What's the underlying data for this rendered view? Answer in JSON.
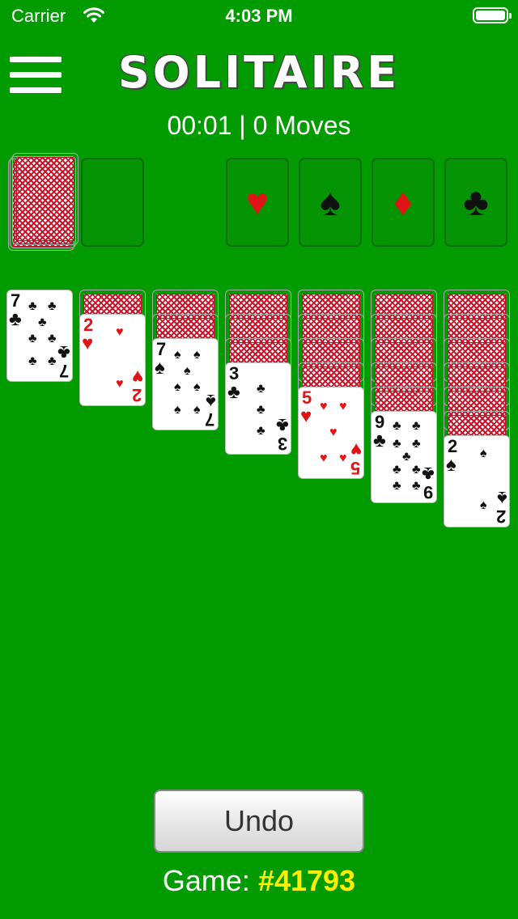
{
  "status_bar": {
    "carrier": "Carrier",
    "time": "4:03 PM"
  },
  "header": {
    "title": "SOLITAIRE",
    "stats": "00:01 | 0 Moves"
  },
  "foundations": [
    {
      "suit": "hearts",
      "glyph": "♥",
      "color": "#e01414"
    },
    {
      "suit": "spades",
      "glyph": "♠",
      "color": "#111111"
    },
    {
      "suit": "diamonds",
      "glyph": "♦",
      "color": "#e01414"
    },
    {
      "suit": "clubs",
      "glyph": "♣",
      "color": "#111111"
    }
  ],
  "tableau": [
    {
      "hidden": 0,
      "top": {
        "rank": "7",
        "suit": "♣",
        "color": "black"
      }
    },
    {
      "hidden": 1,
      "top": {
        "rank": "2",
        "suit": "♥",
        "color": "red"
      }
    },
    {
      "hidden": 2,
      "top": {
        "rank": "7",
        "suit": "♠",
        "color": "black"
      }
    },
    {
      "hidden": 3,
      "top": {
        "rank": "3",
        "suit": "♣",
        "color": "black"
      }
    },
    {
      "hidden": 4,
      "top": {
        "rank": "5",
        "suit": "♥",
        "color": "red"
      }
    },
    {
      "hidden": 5,
      "top": {
        "rank": "9",
        "suit": "♣",
        "color": "black"
      }
    },
    {
      "hidden": 6,
      "top": {
        "rank": "2",
        "suit": "♠",
        "color": "black"
      }
    }
  ],
  "footer": {
    "undo_label": "Undo",
    "game_label": "Game:",
    "game_number": "#41793"
  },
  "colors": {
    "felt": "#029b02",
    "card_back": "#c9142a",
    "game_number": "#ffee00"
  }
}
